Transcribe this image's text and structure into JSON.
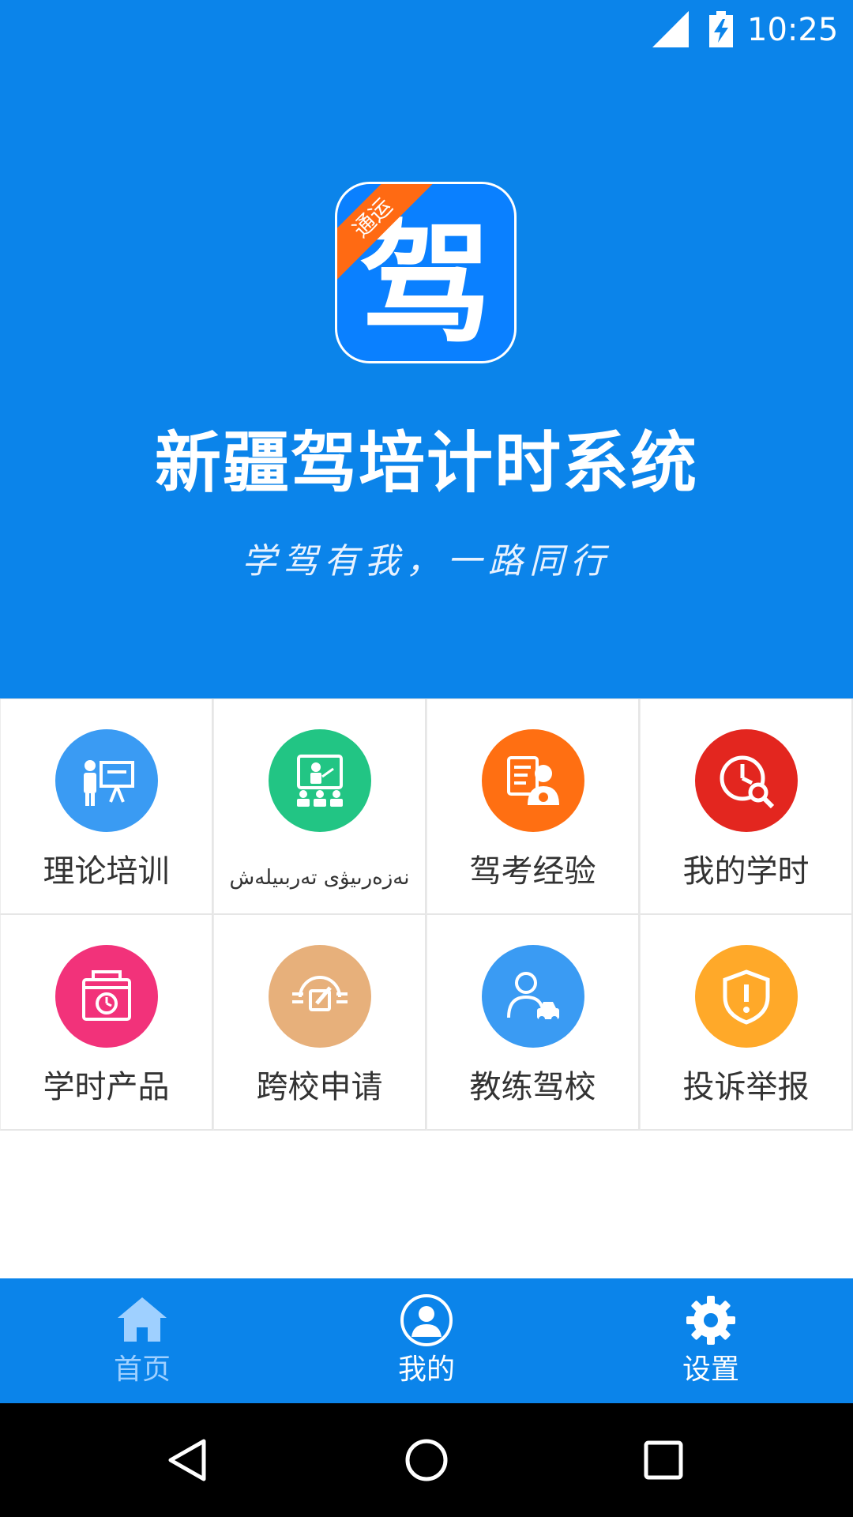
{
  "status_bar": {
    "time": "10:25"
  },
  "hero": {
    "logo_ribbon": "通运",
    "logo_glyph": "驾",
    "title": "新疆驾培计时系统",
    "slogan": "学驾有我，一路同行"
  },
  "grid": {
    "items": [
      {
        "label": "理论培训",
        "icon": "teacher-board-icon",
        "color": "#3a9bf3"
      },
      {
        "label": "نەزەرىيۋى تەربىيلەش",
        "icon": "classroom-icon",
        "color": "#22c584"
      },
      {
        "label": "驾考经验",
        "icon": "driver-document-icon",
        "color": "#ff6f12"
      },
      {
        "label": "我的学时",
        "icon": "clock-search-icon",
        "color": "#e3261f"
      },
      {
        "label": "学时产品",
        "icon": "time-product-icon",
        "color": "#f2327a"
      },
      {
        "label": "跨校申请",
        "icon": "edit-apply-icon",
        "color": "#e7b07b"
      },
      {
        "label": "教练驾校",
        "icon": "coach-car-icon",
        "color": "#3a9bf3"
      },
      {
        "label": "投诉举报",
        "icon": "shield-alert-icon",
        "color": "#ffa929"
      }
    ]
  },
  "bottom_nav": {
    "items": [
      {
        "label": "首页",
        "icon": "home-icon",
        "active": true
      },
      {
        "label": "我的",
        "icon": "user-icon",
        "active": false
      },
      {
        "label": "设置",
        "icon": "gear-icon",
        "active": false
      }
    ]
  },
  "colors": {
    "primary": "#0b84ea",
    "nav_active": "#9fd0ff",
    "ribbon": "#ff6a13"
  }
}
